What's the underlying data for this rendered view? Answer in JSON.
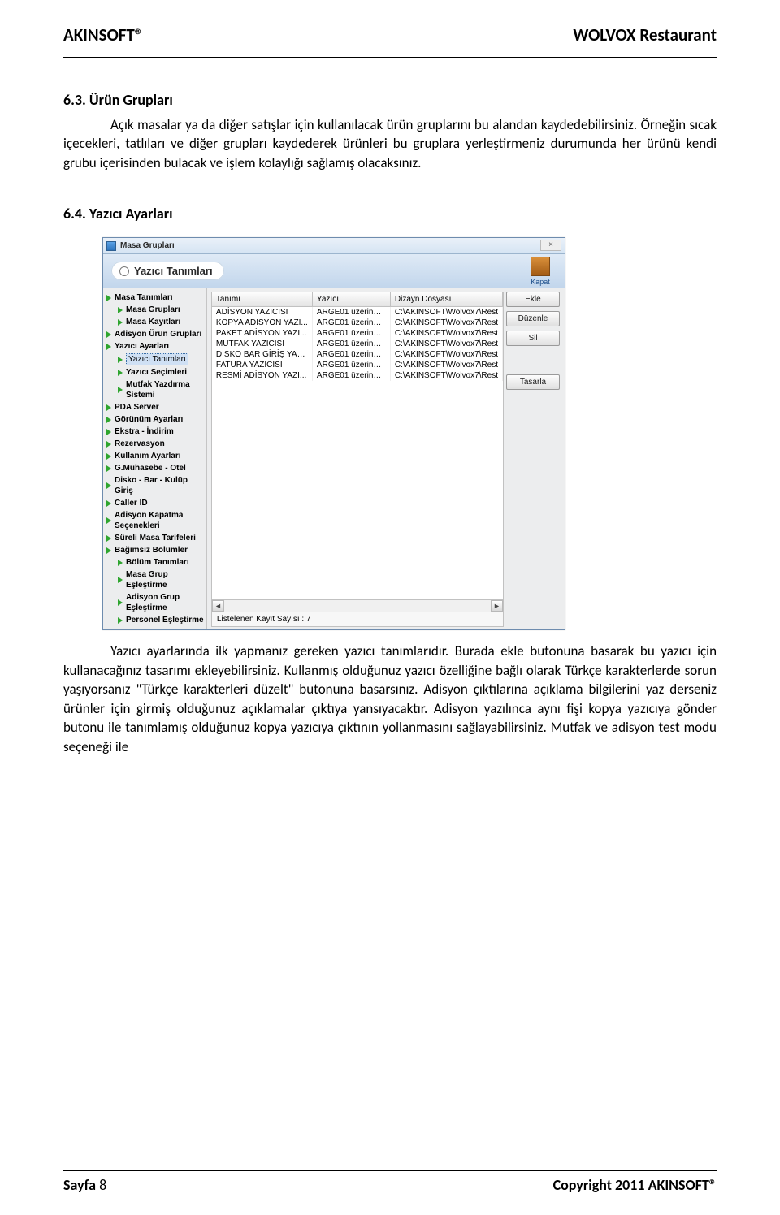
{
  "header": {
    "brand": "AKINSOFT®",
    "product": "WOLVOX Restaurant"
  },
  "section1": {
    "title": "6.3. Ürün Grupları",
    "p1": "Açık masalar ya da diğer satışlar için kullanılacak ürün gruplarını bu alandan kaydedebilirsiniz. Örneğin sıcak içecekleri, tatlıları ve diğer grupları kaydederek ürünleri bu gruplara yerleştirmeniz durumunda her ürünü kendi grubu içerisinden bulacak ve işlem kolaylığı sağlamış olacaksınız."
  },
  "section2": {
    "title": "6.4. Yazıcı Ayarları"
  },
  "app": {
    "title": "Masa Grupları",
    "pill": "Yazıcı Tanımları",
    "closeBtn": "Kapat",
    "sideButtons": {
      "add": "Ekle",
      "edit": "Düzenle",
      "del": "Sil",
      "design": "Tasarla"
    },
    "gridHeaders": {
      "c1": "Tanımı",
      "c2": "Yazıcı",
      "c3": "Dizayn Dosyası"
    },
    "gridFooter": "Listelenen Kayıt Sayısı : 7",
    "rows": [
      {
        "c1": "ADİSYON YAZICISI",
        "c2": "ARGE01 üzerinde ...",
        "c3": "C:\\AKINSOFT\\Wolvox7\\Rest"
      },
      {
        "c1": "KOPYA ADİSYON YAZI...",
        "c2": "ARGE01 üzerinde ...",
        "c3": "C:\\AKINSOFT\\Wolvox7\\Rest"
      },
      {
        "c1": "PAKET ADİSYON YAZI...",
        "c2": "ARGE01 üzerinde ...",
        "c3": "C:\\AKINSOFT\\Wolvox7\\Rest"
      },
      {
        "c1": "MUTFAK YAZICISI",
        "c2": "ARGE01 üzerinde ...",
        "c3": "C:\\AKINSOFT\\Wolvox7\\Rest"
      },
      {
        "c1": "DİSKO BAR GİRİŞ YAZ...",
        "c2": "ARGE01 üzerinde ...",
        "c3": "C:\\AKINSOFT\\Wolvox7\\Rest"
      },
      {
        "c1": "FATURA YAZICISI",
        "c2": "ARGE01 üzerinde ...",
        "c3": "C:\\AKINSOFT\\Wolvox7\\Rest"
      },
      {
        "c1": "RESMİ ADİSYON YAZI...",
        "c2": "ARGE01 üzerinde ...",
        "c3": "C:\\AKINSOFT\\Wolvox7\\Rest"
      }
    ],
    "tree": [
      {
        "label": "Masa Tanımları",
        "cls": "top"
      },
      {
        "label": "Masa Grupları",
        "cls": "child bold"
      },
      {
        "label": "Masa Kayıtları",
        "cls": "child bold"
      },
      {
        "label": "Adisyon Ürün Grupları",
        "cls": "top"
      },
      {
        "label": "Yazıcı Ayarları",
        "cls": "top"
      },
      {
        "label": "Yazıcı Tanımları",
        "cls": "child selected"
      },
      {
        "label": "Yazıcı Seçimleri",
        "cls": "child bold"
      },
      {
        "label": "Mutfak Yazdırma Sistemi",
        "cls": "child bold"
      },
      {
        "label": "PDA Server",
        "cls": "top"
      },
      {
        "label": "Görünüm Ayarları",
        "cls": "top"
      },
      {
        "label": "Ekstra - İndirim",
        "cls": "top"
      },
      {
        "label": "Rezervasyon",
        "cls": "top"
      },
      {
        "label": "Kullanım Ayarları",
        "cls": "top"
      },
      {
        "label": "G.Muhasebe - Otel",
        "cls": "top"
      },
      {
        "label": "Disko - Bar - Kulüp Giriş",
        "cls": "top"
      },
      {
        "label": "Caller ID",
        "cls": "top"
      },
      {
        "label": "Adisyon Kapatma Seçenekleri",
        "cls": "top"
      },
      {
        "label": "Süreli Masa Tarifeleri",
        "cls": "top"
      },
      {
        "label": "Bağımsız Bölümler",
        "cls": "top"
      },
      {
        "label": "Bölüm Tanımları",
        "cls": "child bold"
      },
      {
        "label": "Masa Grup Eşleştirme",
        "cls": "child bold"
      },
      {
        "label": "Adisyon Grup Eşleştirme",
        "cls": "child bold"
      },
      {
        "label": "Personel Eşleştirme",
        "cls": "child bold"
      }
    ]
  },
  "para2": "Yazıcı ayarlarında ilk yapmanız gereken yazıcı tanımlarıdır. Burada ekle butonuna basarak bu yazıcı için kullanacağınız tasarımı ekleyebilirsiniz. Kullanmış olduğunuz yazıcı özelliğine bağlı olarak Türkçe karakterlerde sorun yaşıyorsanız \"Türkçe karakterleri düzelt\" butonuna basarsınız. Adisyon çıktılarına açıklama bilgilerini yaz derseniz ürünler için girmiş olduğunuz açıklamalar çıktıya yansıyacaktır. Adisyon yazılınca aynı fişi kopya yazıcıya gönder butonu ile tanımlamış olduğunuz kopya yazıcıya çıktının yollanmasını sağlayabilirsiniz. Mutfak ve adisyon test modu seçeneği ile",
  "footer": {
    "pageLabel": "Sayfa",
    "pageNum": "8",
    "copyright": "Copyright 2011 AKINSOFT®"
  }
}
